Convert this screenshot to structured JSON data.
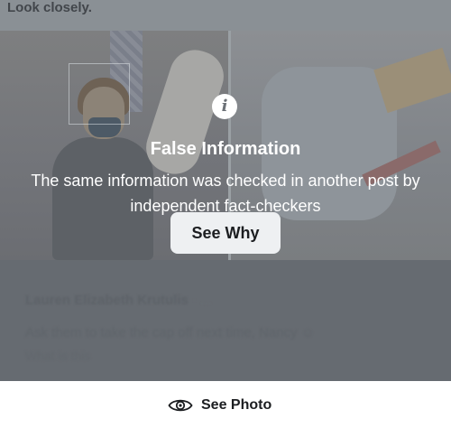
{
  "post": {
    "caption": "Look closely."
  },
  "fact_check": {
    "icon": "info-icon",
    "title": "False Information",
    "description": "The same information was checked in another post by independent fact-checkers",
    "button_label": "See Why"
  },
  "comment": {
    "author": "Lauren Elizabeth Krutulis",
    "meta": "· ...",
    "text": "Ask them to take the cap off next time, Nancy ☺",
    "text2": "What is this"
  },
  "footer": {
    "icon": "eye-icon",
    "see_photo_label": "See Photo"
  },
  "colors": {
    "overlay_text": "#ffffff",
    "button_bg": "#eef0f2",
    "button_text": "#1c1e21"
  }
}
